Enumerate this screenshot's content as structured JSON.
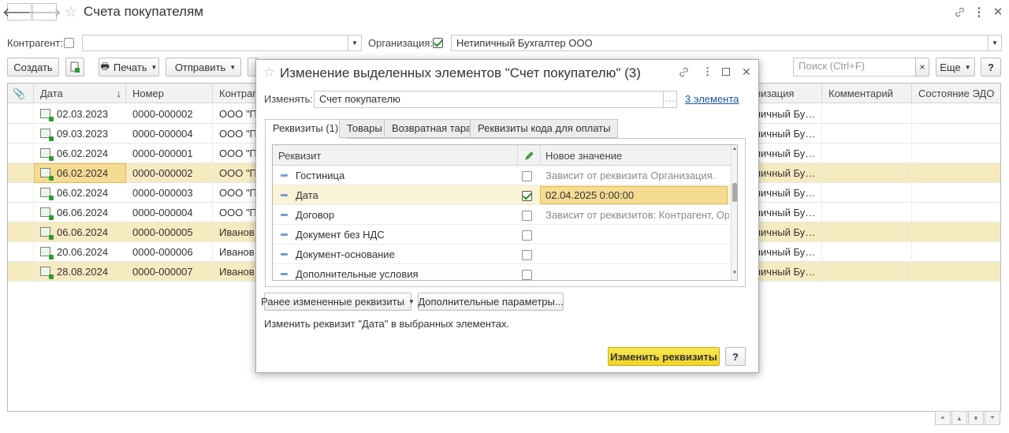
{
  "window": {
    "title": "Счета покупателям"
  },
  "filters": {
    "counterparty_label": "Контрагент:",
    "counterparty_value": "",
    "organization_label": "Организация:",
    "organization_value": "Нетипичный Бухгалтер ООО"
  },
  "toolbar": {
    "create": "Создать",
    "print": "Печать",
    "send": "Отправить",
    "search_placeholder": "Поиск (Ctrl+F)",
    "search_clear": "×",
    "more": "Еще",
    "help": "?"
  },
  "table": {
    "columns": [
      "Дата",
      "Номер",
      "Контраге",
      "низация",
      "Комментарий",
      "Состояние ЭДО"
    ],
    "rows": [
      {
        "date": "02.03.2023",
        "number": "0000-000002",
        "counterparty": "ООО \"По",
        "organization": "пичный Бу…",
        "highlight": false
      },
      {
        "date": "09.03.2023",
        "number": "0000-000004",
        "counterparty": "ООО \"По",
        "organization": "пичный Бу…",
        "highlight": false
      },
      {
        "date": "06.02.2024",
        "number": "0000-000001",
        "counterparty": "ООО \"По",
        "organization": "пичный Бу…",
        "highlight": false
      },
      {
        "date": "06.02.2024",
        "number": "0000-000002",
        "counterparty": "ООО \"По",
        "organization": "пичный Бу…",
        "highlight": true
      },
      {
        "date": "06.02.2024",
        "number": "0000-000003",
        "counterparty": "ООО \"По",
        "organization": "пичный Бу…",
        "highlight": false
      },
      {
        "date": "06.06.2024",
        "number": "0000-000004",
        "counterparty": "ООО \"По",
        "organization": "пичный Бу…",
        "highlight": false
      },
      {
        "date": "06.06.2024",
        "number": "0000-000005",
        "counterparty": "Иванов И",
        "organization": "пичный Бу…",
        "highlight": true
      },
      {
        "date": "20.06.2024",
        "number": "0000-000006",
        "counterparty": "Иванов И",
        "organization": "пичный Бу…",
        "highlight": false
      },
      {
        "date": "28.08.2024",
        "number": "0000-000007",
        "counterparty": "Иванов И",
        "organization": "пичный Бу…",
        "highlight": true
      }
    ]
  },
  "dialog": {
    "title": "Изменение выделенных элементов \"Счет покупателю\" (3)",
    "change_label": "Изменять:",
    "change_value": "Счет покупателю",
    "elements_link": "3 элемента",
    "tabs": [
      "Реквизиты (1)",
      "Товары",
      "Возвратная тара",
      "Реквизиты кода для оплаты"
    ],
    "grid_headers": {
      "attribute": "Реквизит",
      "new_value": "Новое значение"
    },
    "items": [
      {
        "name": "Гостиница",
        "checked": false,
        "value": "Зависит от реквизита Организация."
      },
      {
        "name": "Дата",
        "checked": true,
        "value": "02.04.2025 0:00:00"
      },
      {
        "name": "Договор",
        "checked": false,
        "value": "Зависит от реквизитов: Контрагент, Орг…"
      },
      {
        "name": "Документ без НДС",
        "checked": false,
        "value": ""
      },
      {
        "name": "Документ-основание",
        "checked": false,
        "value": ""
      },
      {
        "name": "Дополнительные условия",
        "checked": false,
        "value": ""
      }
    ],
    "prev_changed_button": "Ранее измененные реквизиты",
    "extra_params_button": "Дополнительные параметры...",
    "status_text": "Изменить реквизит \"Дата\" в выбранных элементах.",
    "apply_button": "Изменить реквизиты",
    "help_button": "?"
  },
  "colors": {
    "highlight_row": "#f6eac0",
    "selected_cell": "#f6dc93",
    "primary_button": "#f5e043",
    "link": "#1a55a8"
  }
}
